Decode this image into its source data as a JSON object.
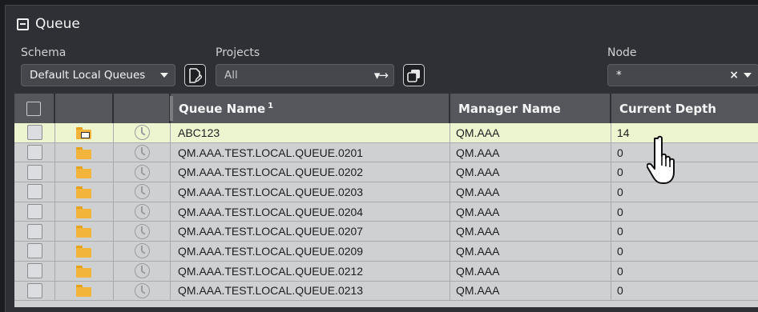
{
  "panel": {
    "title": "Queue",
    "collapse_icon": "minus-square-icon"
  },
  "filters": {
    "schema": {
      "label": "Schema",
      "value": "Default Local Queues"
    },
    "projects": {
      "label": "Projects",
      "value": "All"
    },
    "node": {
      "label": "Node",
      "value": "*"
    }
  },
  "table": {
    "columns": {
      "queue_name": "Queue Name",
      "queue_name_sort": "1",
      "manager_name": "Manager Name",
      "current_depth": "Current Depth"
    },
    "rows": [
      {
        "queue_name": "ABC123",
        "manager_name": "QM.AAA",
        "current_depth": "14",
        "has_messages": true,
        "selected": true
      },
      {
        "queue_name": "QM.AAA.TEST.LOCAL.QUEUE.0201",
        "manager_name": "QM.AAA",
        "current_depth": "0"
      },
      {
        "queue_name": "QM.AAA.TEST.LOCAL.QUEUE.0202",
        "manager_name": "QM.AAA",
        "current_depth": "0"
      },
      {
        "queue_name": "QM.AAA.TEST.LOCAL.QUEUE.0203",
        "manager_name": "QM.AAA",
        "current_depth": "0"
      },
      {
        "queue_name": "QM.AAA.TEST.LOCAL.QUEUE.0204",
        "manager_name": "QM.AAA",
        "current_depth": "0"
      },
      {
        "queue_name": "QM.AAA.TEST.LOCAL.QUEUE.0207",
        "manager_name": "QM.AAA",
        "current_depth": "0"
      },
      {
        "queue_name": "QM.AAA.TEST.LOCAL.QUEUE.0209",
        "manager_name": "QM.AAA",
        "current_depth": "0"
      },
      {
        "queue_name": "QM.AAA.TEST.LOCAL.QUEUE.0212",
        "manager_name": "QM.AAA",
        "current_depth": "0"
      },
      {
        "queue_name": "QM.AAA.TEST.LOCAL.QUEUE.0213",
        "manager_name": "QM.AAA",
        "current_depth": "0"
      }
    ]
  },
  "colors": {
    "selected_row": "#ecf5cf",
    "row": "#cfd0d2",
    "header": "#55575c",
    "folder": "#f2b43a"
  }
}
